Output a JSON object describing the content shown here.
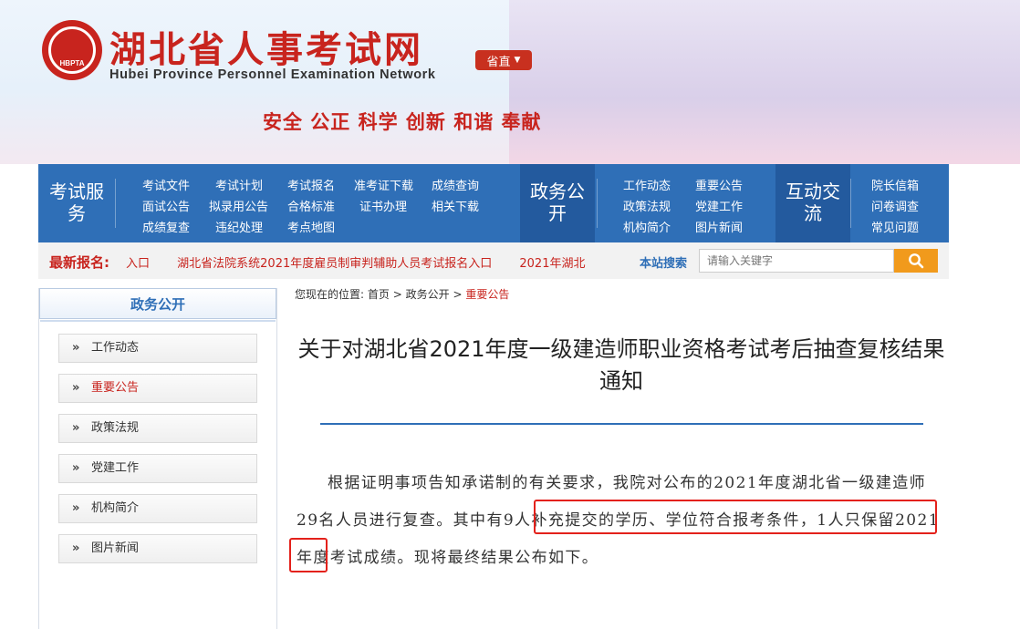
{
  "header": {
    "logo_text": "HBPTA",
    "title": "湖北省人事考试网",
    "subtitle": "Hubei Province Personnel Examination Network",
    "province_button": "省直",
    "slogan": "安全 公正 科学 创新 和谐 奉献"
  },
  "nav": {
    "groups": [
      {
        "title": "考试服务",
        "links": [
          "考试文件",
          "考试计划",
          "考试报名",
          "准考证下载",
          "成绩查询",
          "面试公告",
          "拟录用公告",
          "合格标准",
          "证书办理",
          "相关下载",
          "成绩复查",
          "违纪处理",
          "考点地图"
        ]
      },
      {
        "title": "政务公开",
        "links": [
          "工作动态",
          "重要公告",
          "政策法规",
          "党建工作",
          "机构简介",
          "图片新闻"
        ]
      },
      {
        "title": "互动交流",
        "links": [
          "院长信箱",
          "问卷调查",
          "常见问题"
        ]
      }
    ]
  },
  "ticker": {
    "label": "最新报名:",
    "items": [
      "入口",
      "湖北省法院系统2021年度雇员制审判辅助人员考试报名入口",
      "2021年湖北"
    ],
    "search_label": "本站搜索",
    "search_placeholder": "请输入关键字"
  },
  "sidebar": {
    "title": "政务公开",
    "items": [
      {
        "label": "工作动态",
        "active": false
      },
      {
        "label": "重要公告",
        "active": true
      },
      {
        "label": "政策法规",
        "active": false
      },
      {
        "label": "党建工作",
        "active": false
      },
      {
        "label": "机构简介",
        "active": false
      },
      {
        "label": "图片新闻",
        "active": false
      }
    ]
  },
  "breadcrumb": {
    "prefix": "您现在的位置:",
    "home": "首页",
    "section": "政务公开",
    "current": "重要公告",
    "sep": ">"
  },
  "article": {
    "title": "关于对湖北省2021年度一级建造师职业资格考试考后抽查复核结果通知",
    "body_part1": "根据证明事项告知承诺制的有关要求，我院对公布的2021年度湖北省一级建造师29名人员进行复查。",
    "body_part2": "其中有9人补充提交的学历、学位符合报考条件，",
    "body_part3": "1人只保留2021年度考试成绩。现将最终结果公布如下。"
  },
  "colors": {
    "brand_red": "#c8241e",
    "nav_blue": "#2f6fb7",
    "search_orange": "#f19a1c",
    "highlight_red": "#e3211b"
  }
}
